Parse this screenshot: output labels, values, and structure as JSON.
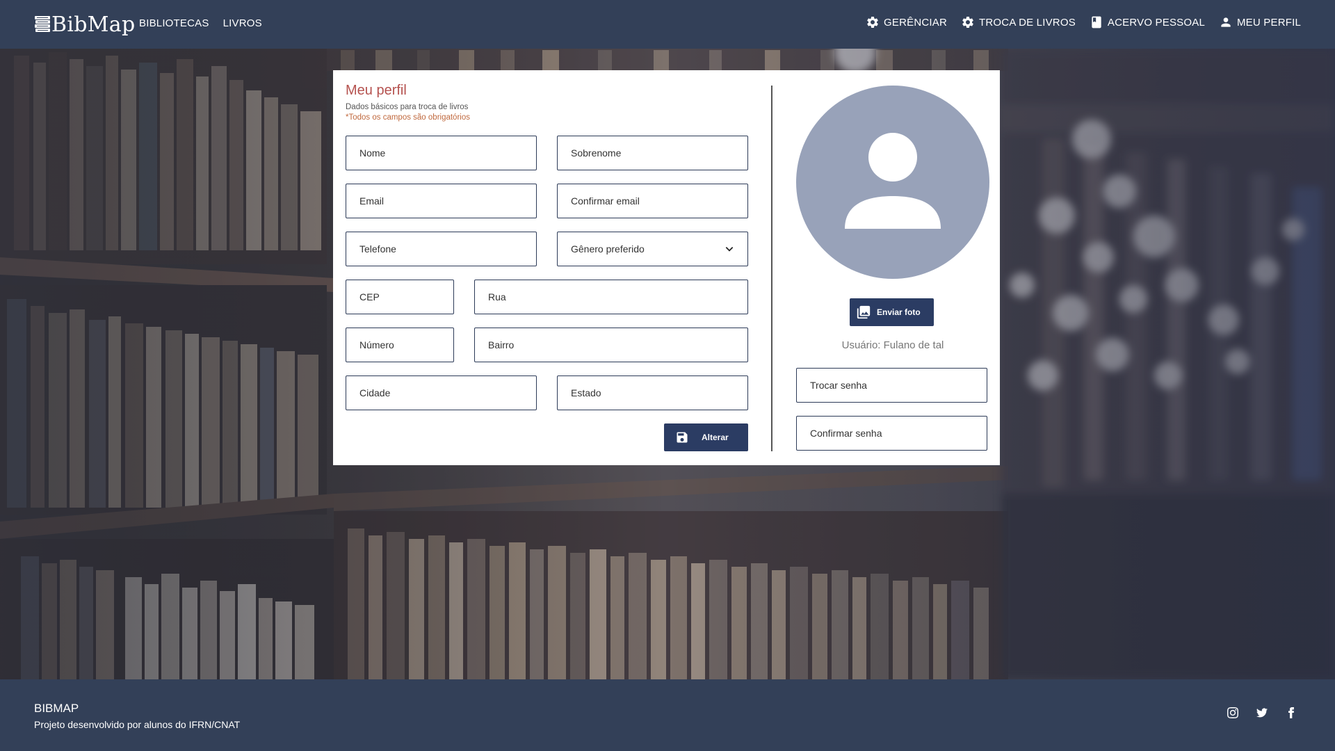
{
  "navbar": {
    "logo": "BibMap",
    "links": [
      "BIBLIOTECAS",
      "LIVROS"
    ],
    "menu": {
      "manage": "GERÊNCIAR",
      "exchange": "TROCA DE LIVROS",
      "collection": "ACERVO PESSOAL",
      "profile": "MEU PERFIL"
    }
  },
  "profile": {
    "title": "Meu perfil",
    "subtitle": "Dados básicos para troca de livros",
    "required_note": "*Todos os campos são obrigatórios",
    "fields": {
      "nome": "Nome",
      "sobrenome": "Sobrenome",
      "email": "Email",
      "confirmar_email": "Confirmar email",
      "telefone": "Telefone",
      "genero": "Gênero preferido",
      "cep": "CEP",
      "rua": "Rua",
      "numero": "Número",
      "bairro": "Bairro",
      "cidade": "Cidade",
      "estado": "Estado"
    },
    "save_button": "Alterar",
    "upload_button": "Enviar foto",
    "username_text": "Usuário: Fulano de tal",
    "password_fields": {
      "new": "Trocar senha",
      "confirm": "Confirmar senha"
    }
  },
  "footer": {
    "brand": "BIBMAP",
    "description": "Projeto desenvolvido por alunos do IFRN/CNAT",
    "social": [
      "instagram-icon",
      "twitter-icon",
      "facebook-icon"
    ]
  },
  "colors": {
    "navbar": "#334058",
    "primary_button": "#2b3c63",
    "title": "#b5524f",
    "required_note": "#c0693e",
    "avatar": "#98a2b9"
  }
}
